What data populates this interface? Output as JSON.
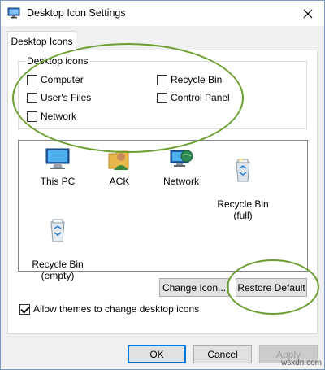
{
  "window": {
    "title": "Desktop Icon Settings",
    "icons": {
      "app": "desktop-settings-icon",
      "close": "close-icon"
    }
  },
  "tabs": [
    {
      "label": "Desktop Icons",
      "active": true
    }
  ],
  "desktop_icons_group": {
    "legend": "Desktop icons",
    "checkboxes": [
      {
        "label": "Computer",
        "checked": false
      },
      {
        "label": "Recycle Bin",
        "checked": false
      },
      {
        "label": "User's Files",
        "checked": false
      },
      {
        "label": "Control Panel",
        "checked": false
      },
      {
        "label": "Network",
        "checked": false
      }
    ]
  },
  "icon_list": [
    {
      "label": "This PC",
      "icon": "computer-monitor-icon"
    },
    {
      "label": "ACK",
      "icon": "user-folder-icon"
    },
    {
      "label": "Network",
      "icon": "network-globe-icon"
    },
    {
      "label": "Recycle Bin\n(full)",
      "icon": "recycle-bin-full-icon"
    },
    {
      "label": "Recycle Bin\n(empty)",
      "icon": "recycle-bin-empty-icon"
    }
  ],
  "buttons": {
    "change_icon": "Change Icon...",
    "restore_default": "Restore Default",
    "ok": "OK",
    "cancel": "Cancel",
    "apply": "Apply"
  },
  "themes_checkbox": {
    "label": "Allow themes to change desktop icons",
    "checked": true
  },
  "annotation_color": "#6c9f2f",
  "watermark": "wsxdn.com"
}
